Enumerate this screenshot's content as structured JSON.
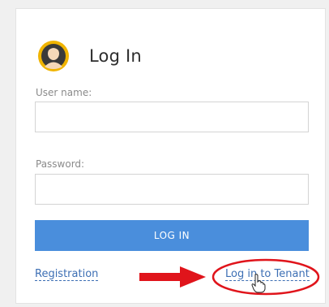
{
  "login": {
    "title": "Log In",
    "username_label": "User name:",
    "username_value": "",
    "password_label": "Password:",
    "password_value": "",
    "submit_label": "LOG IN"
  },
  "links": {
    "registration": "Registration",
    "tenant": "Log in to Tenant"
  },
  "icons": {
    "avatar": "user-avatar-icon",
    "arrow": "right-arrow-icon",
    "cursor": "hand-pointer-icon"
  },
  "colors": {
    "button": "#4a8edc",
    "link": "#3d6fb4",
    "annotation": "#e0141b"
  }
}
